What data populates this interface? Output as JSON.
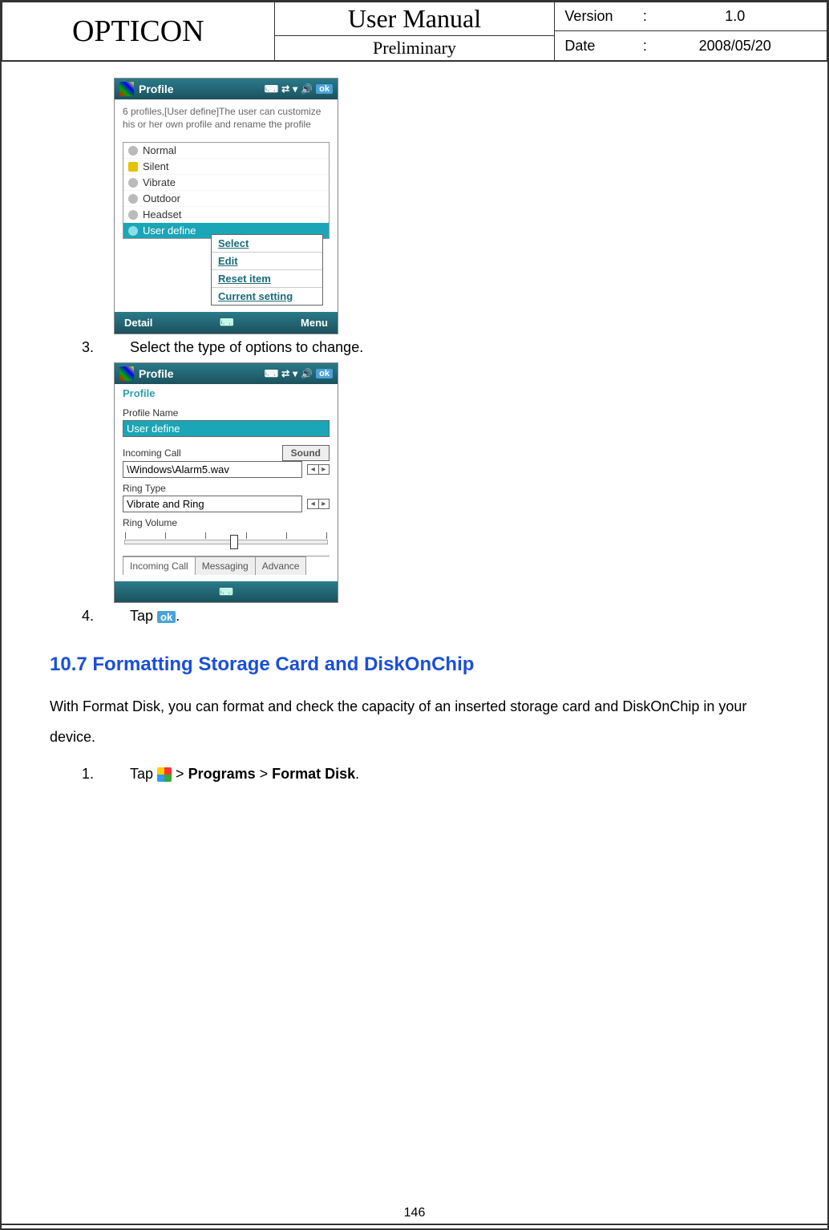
{
  "header": {
    "brand": "OPTICON",
    "title": "User Manual",
    "subtitle": "Preliminary",
    "version_label": "Version",
    "version_value": "1.0",
    "date_label": "Date",
    "date_value": "2008/05/20"
  },
  "screenshot1": {
    "title": "Profile",
    "ok": "ok",
    "hint": "6 profiles,[User define]The user can customize his or her own profile and rename the profile",
    "items": [
      "Normal",
      "Silent",
      "Vibrate",
      "Outdoor",
      "Headset",
      "User define"
    ],
    "menu": {
      "select": "Select",
      "edit": "Edit",
      "reset": "Reset item",
      "current": "Current setting"
    },
    "softkeys": {
      "left": "Detail",
      "right": "Menu"
    }
  },
  "step3": {
    "num": "3.",
    "text": "Select the type of options to change."
  },
  "screenshot2": {
    "title": "Profile",
    "ok": "ok",
    "section": "Profile",
    "labels": {
      "profile_name": "Profile Name",
      "profile_name_val": "User define",
      "incoming_call": "Incoming Call",
      "sound_btn": "Sound",
      "incoming_call_val": "\\Windows\\Alarm5.wav",
      "ring_type": "Ring Type",
      "ring_type_val": "Vibrate and Ring",
      "ring_volume": "Ring Volume"
    },
    "tabs": [
      "Incoming Call",
      "Messaging",
      "Advance"
    ]
  },
  "step4": {
    "num": "4.",
    "text_before": "Tap ",
    "ok": "ok",
    "text_after": "."
  },
  "section_heading": "10.7 Formatting Storage Card and DiskOnChip",
  "body_para": "With Format Disk, you can format and check the capacity of an inserted storage card and DiskOnChip in your device.",
  "step_fd": {
    "num": "1.",
    "text_before": "Tap ",
    "gt1": " > ",
    "programs": "Programs",
    "gt2": " > ",
    "format_disk": "Format Disk",
    "period": "."
  },
  "page_number": "146"
}
